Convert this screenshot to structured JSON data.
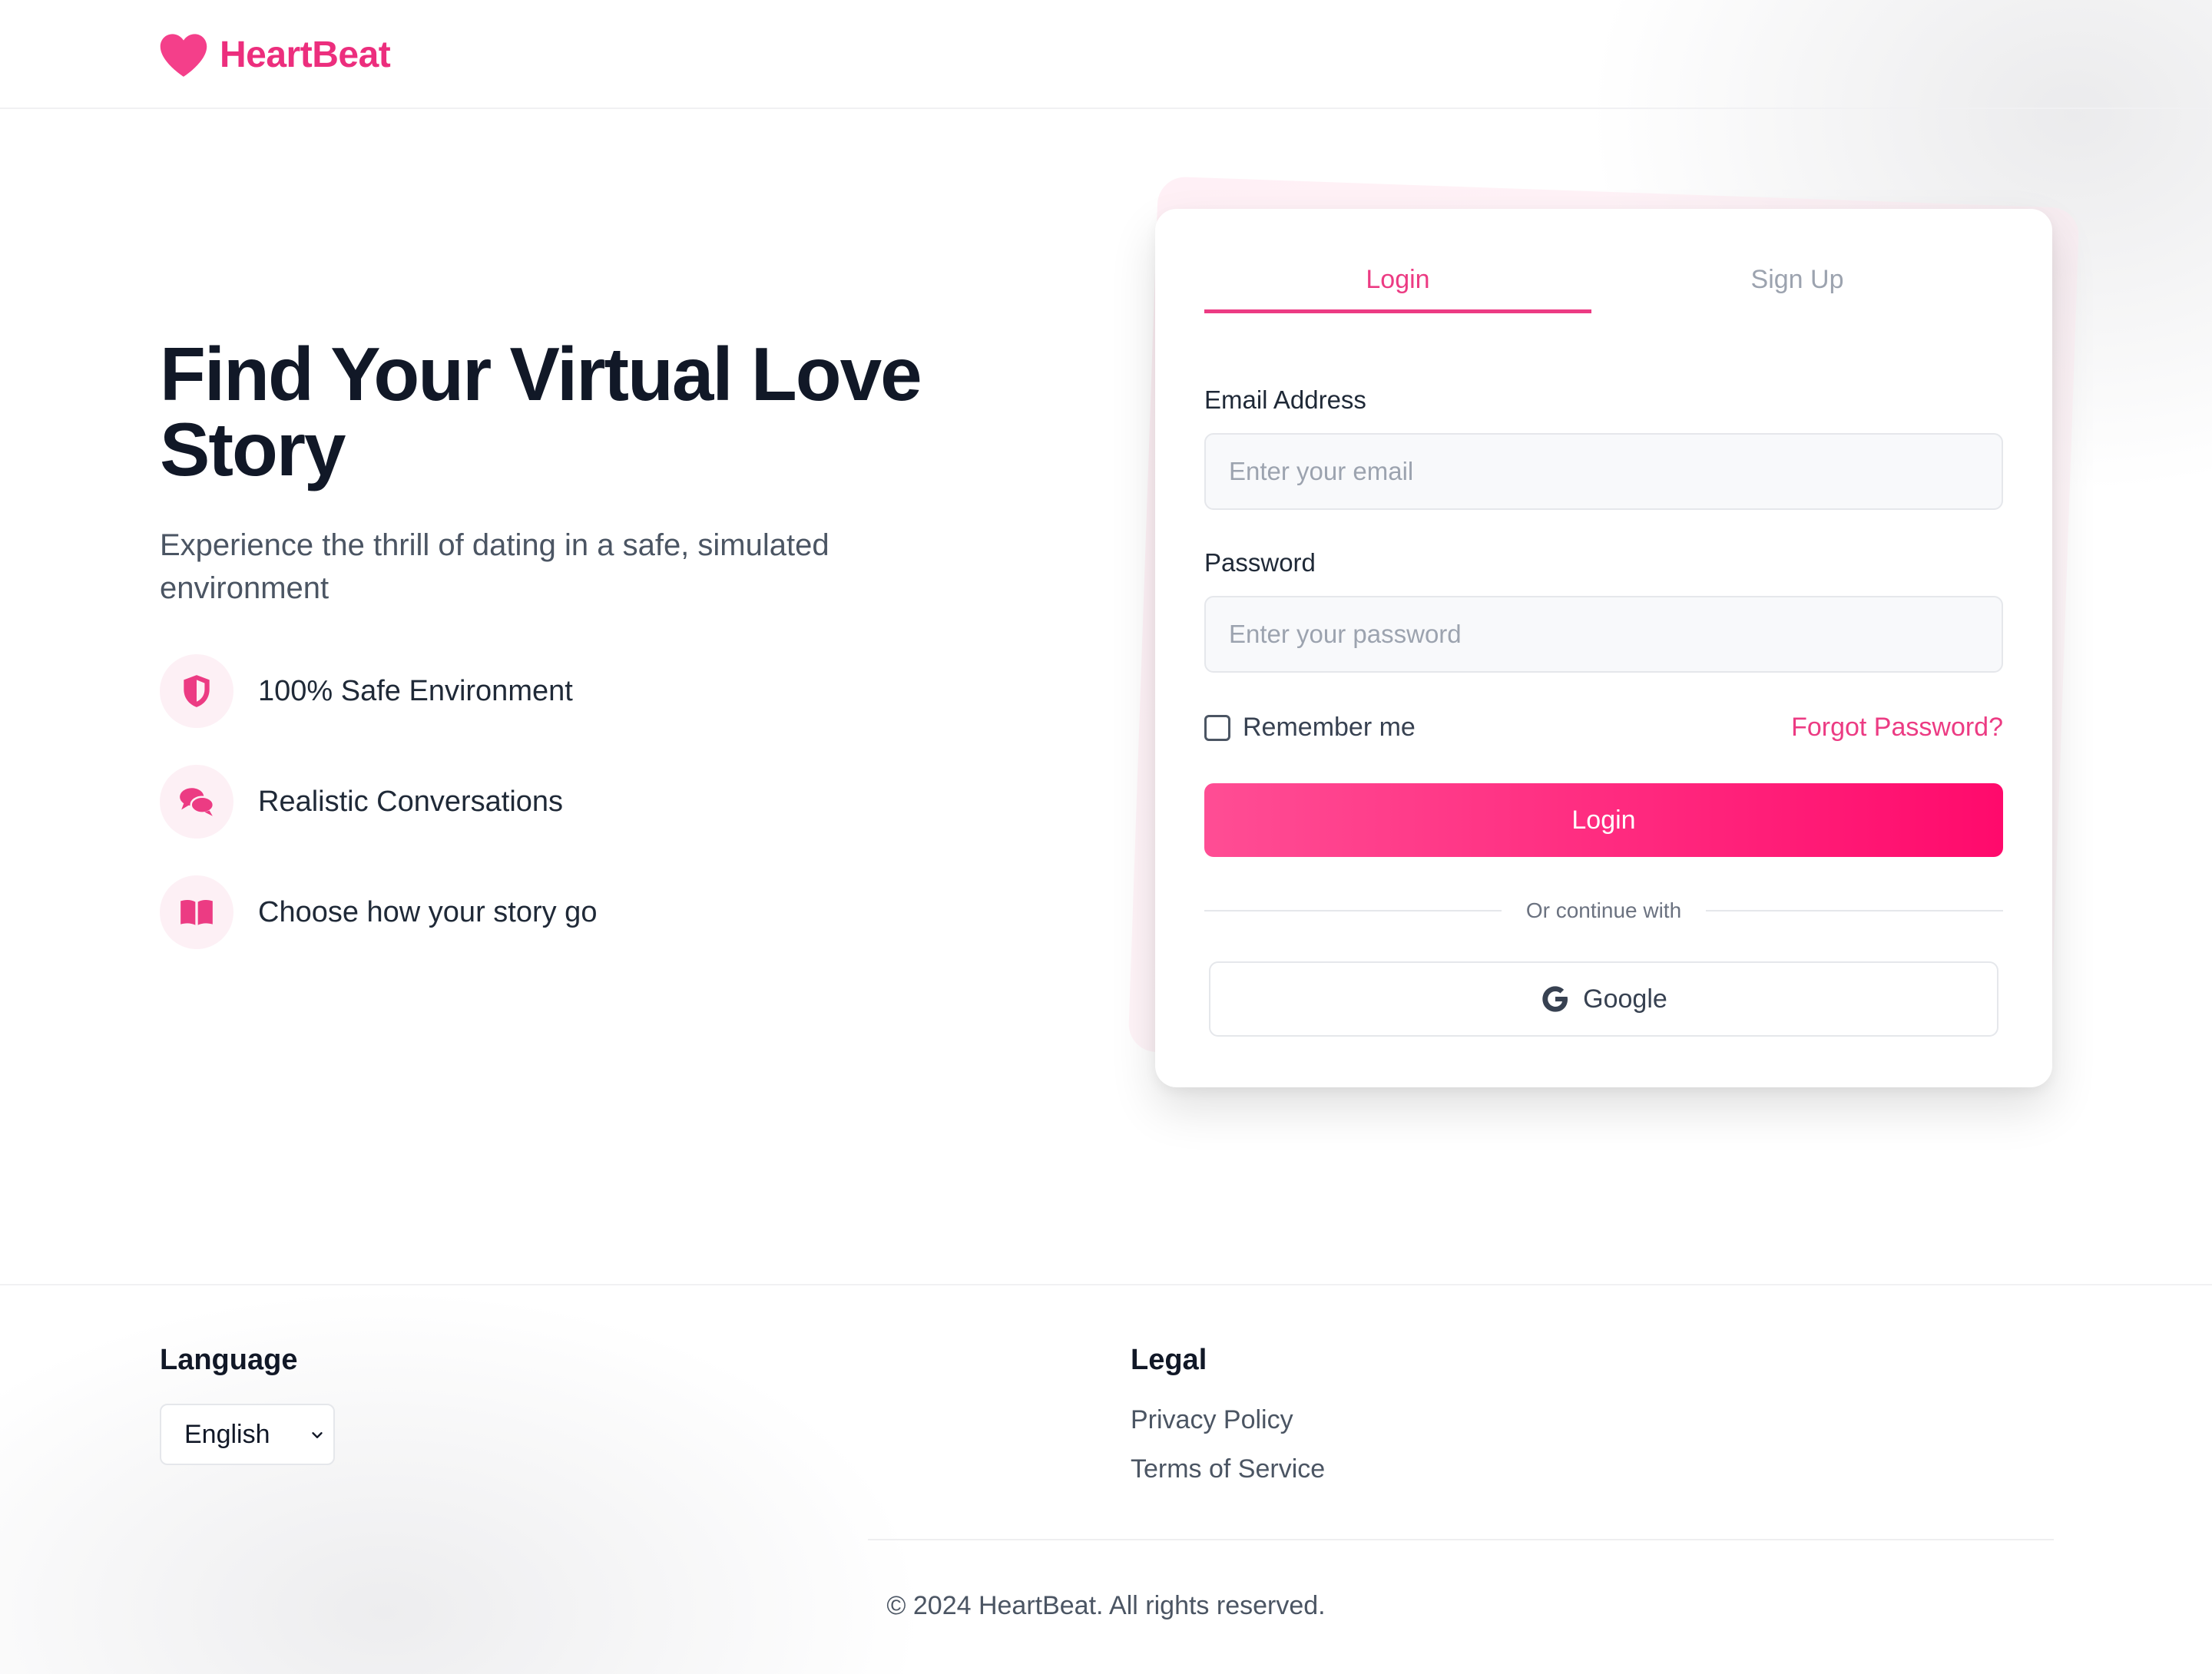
{
  "brand": {
    "name": "HeartBeat",
    "color": "#ec2e7d",
    "icon": "heart-icon"
  },
  "hero": {
    "title": "Find Your Virtual Love Story",
    "subtitle": "Experience the thrill of dating in a safe, simulated environment",
    "features": [
      {
        "icon": "shield-icon",
        "label": "100% Safe Environment"
      },
      {
        "icon": "chat-bubbles-icon",
        "label": "Realistic Conversations"
      },
      {
        "icon": "book-open-icon",
        "label": "Choose how your story go"
      }
    ]
  },
  "auth": {
    "tabs": [
      {
        "label": "Login",
        "active": true
      },
      {
        "label": "Sign Up",
        "active": false
      }
    ],
    "email": {
      "label": "Email Address",
      "placeholder": "Enter your email",
      "value": ""
    },
    "password": {
      "label": "Password",
      "placeholder": "Enter your password",
      "value": ""
    },
    "remember_label": "Remember me",
    "remember_checked": false,
    "forgot_label": "Forgot Password?",
    "login_button": "Login",
    "divider_text": "Or continue with",
    "google_label": "Google",
    "accent": "#ff1a74"
  },
  "footer": {
    "language_heading": "Language",
    "language_selected": "English",
    "legal_heading": "Legal",
    "legal_links": [
      "Privacy Policy",
      "Terms of Service"
    ],
    "copyright": "© 2024 HeartBeat. All rights reserved."
  }
}
